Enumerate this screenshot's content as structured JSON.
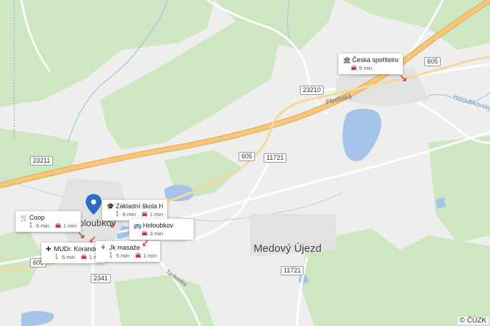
{
  "map": {
    "places": {
      "town_main": "Medový Újezd",
      "town_left": "Holoubkov",
      "street": "Plzeňská",
      "river": "Holoubkovský p.",
      "street2": "Tankovka"
    },
    "road_shields": [
      "605",
      "23210",
      "23211",
      "605",
      "11721",
      "2341",
      "11721",
      "605"
    ],
    "colors": {
      "background": "#eeeeec",
      "forest": "#cfe6c2",
      "motorway": "#f7c67a",
      "road": "#ffffff",
      "water": "#a6c4ea",
      "pin": "#2d6cc0"
    }
  },
  "pois": [
    {
      "name": "Česká spořitelna",
      "icon": "bank-icon",
      "walk": "",
      "car": "5 min"
    },
    {
      "name": "Coop",
      "icon": "cart-icon",
      "walk": "6 min",
      "car": "1 min"
    },
    {
      "name": "Základní škola Ho...",
      "icon": "school-icon",
      "walk": "6 min",
      "car": "1 min"
    },
    {
      "name": "Holoubkov",
      "icon": "bus-icon",
      "walk": "",
      "car": "3 min"
    },
    {
      "name": "MUDr. Korandová",
      "icon": "medical-icon",
      "walk": "5 min",
      "car": "1 min"
    },
    {
      "name": "Jk masáže",
      "icon": "massage-icon",
      "walk": "5 min",
      "car": "1 min"
    }
  ],
  "attribution": "© ČÚZK"
}
